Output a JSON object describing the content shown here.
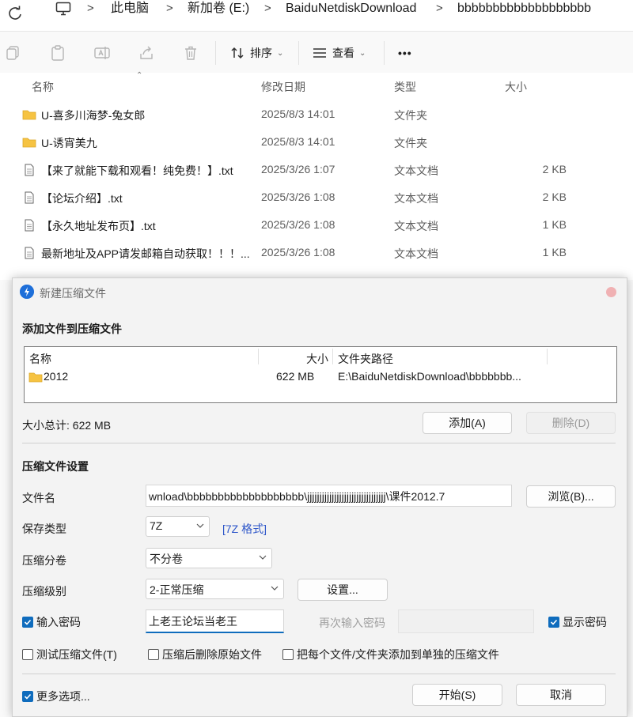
{
  "explorer": {
    "breadcrumbs": [
      "此电脑",
      "新加卷 (E:)",
      "BaiduNetdiskDownload",
      "bbbbbbbbbbbbbbbbbbb"
    ],
    "toolbar": {
      "sort_label": "排序",
      "view_label": "查看",
      "more_label": "•••"
    },
    "columns": {
      "name": "名称",
      "date": "修改日期",
      "type": "类型",
      "size": "大小"
    },
    "files": [
      {
        "name": "U-喜多川海梦-兔女郎",
        "date": "2025/8/3 14:01",
        "type": "文件夹",
        "size": "",
        "icon": "folder"
      },
      {
        "name": "U-诱宵美九",
        "date": "2025/8/3 14:01",
        "type": "文件夹",
        "size": "",
        "icon": "folder"
      },
      {
        "name": "【来了就能下载和观看！纯免费！】.txt",
        "date": "2025/3/26 1:07",
        "type": "文本文档",
        "size": "2 KB",
        "icon": "text-file"
      },
      {
        "name": "【论坛介绍】.txt",
        "date": "2025/3/26 1:08",
        "type": "文本文档",
        "size": "2 KB",
        "icon": "text-file"
      },
      {
        "name": "【永久地址发布页】.txt",
        "date": "2025/3/26 1:08",
        "type": "文本文档",
        "size": "1 KB",
        "icon": "text-file"
      },
      {
        "name": "最新地址及APP请发邮箱自动获取！！！...",
        "date": "2025/3/26 1:08",
        "type": "文本文档",
        "size": "1 KB",
        "icon": "text-file"
      }
    ]
  },
  "dialog": {
    "title": "新建压缩文件",
    "add_section_title": "添加文件到压缩文件",
    "list_headers": {
      "name": "名称",
      "size": "大小",
      "path": "文件夹路径"
    },
    "list_items": [
      {
        "name": "2012",
        "size": "622 MB",
        "path": "E:\\BaiduNetdiskDownload\\bbbbbbb..."
      }
    ],
    "total_size": "大小总计: 622 MB",
    "add_button": "添加(A)",
    "delete_button": "删除(D)",
    "settings_section_title": "压缩文件设置",
    "filename_label": "文件名",
    "filename_value": "wnload\\bbbbbbbbbbbbbbbbbbb\\jjjjjjjjjjjjjjjjjjjjjjjjjjjjjjjj\\课件2012.7",
    "browse_button": "浏览(B)...",
    "save_type_label": "保存类型",
    "save_type_value": "7Z",
    "format_link": "[7Z 格式]",
    "split_label": "压缩分卷",
    "split_value": "不分卷",
    "level_label": "压缩级别",
    "level_value": "2-正常压缩",
    "settings_button": "设置...",
    "password_checkbox": "输入密码",
    "password_value": "上老王论坛当老王",
    "reenter_password_label": "再次输入密码",
    "show_password_checkbox": "显示密码",
    "test_checkbox": "测试压缩文件(T)",
    "delete_after_checkbox": "压缩后删除原始文件",
    "separate_checkbox": "把每个文件/文件夹添加到单独的压缩文件",
    "more_options_checkbox": "更多选项...",
    "start_button": "开始(S)",
    "cancel_button": "取消"
  }
}
